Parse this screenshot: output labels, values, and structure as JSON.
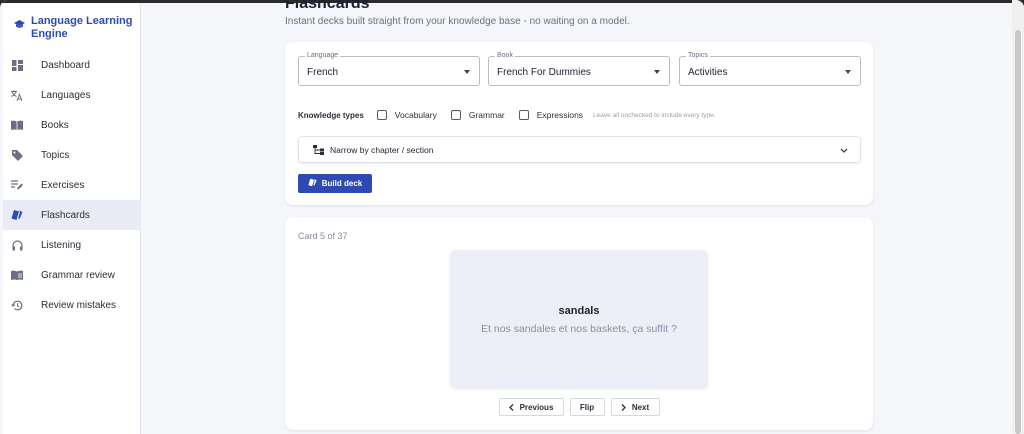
{
  "app": {
    "brand": "Language Learning Engine"
  },
  "sidebar": {
    "items": [
      {
        "label": "Dashboard",
        "icon": "dashboard-icon"
      },
      {
        "label": "Languages",
        "icon": "translate-icon"
      },
      {
        "label": "Books",
        "icon": "book-icon"
      },
      {
        "label": "Topics",
        "icon": "tag-icon"
      },
      {
        "label": "Exercises",
        "icon": "edit-list-icon"
      },
      {
        "label": "Flashcards",
        "icon": "cards-icon",
        "active": true
      },
      {
        "label": "Listening",
        "icon": "headphones-icon"
      },
      {
        "label": "Grammar review",
        "icon": "grammar-book-icon"
      },
      {
        "label": "Review mistakes",
        "icon": "history-icon"
      }
    ]
  },
  "page": {
    "title": "Flashcards",
    "subtitle": "Instant decks built straight from your knowledge base - no waiting on a model."
  },
  "filters": {
    "language": {
      "label": "Language",
      "value": "French"
    },
    "book": {
      "label": "Book",
      "value": "French For Dummies"
    },
    "topics": {
      "label": "Topics",
      "value": "Activities"
    },
    "knowledge_types_label": "Knowledge types",
    "types": [
      "Vocabulary",
      "Grammar",
      "Expressions"
    ],
    "hint": "Leave all unchecked to include every type.",
    "narrow_label": "Narrow by chapter / section",
    "build_label": "Build deck"
  },
  "deck": {
    "counter": "Card 5 of 37",
    "front": "sandals",
    "back": "Et nos sandales et nos baskets, ça suffit ?",
    "prev_label": "Previous",
    "flip_label": "Flip",
    "next_label": "Next"
  },
  "colors": {
    "accent": "#2f49b3",
    "card_face": "#eceef8"
  }
}
